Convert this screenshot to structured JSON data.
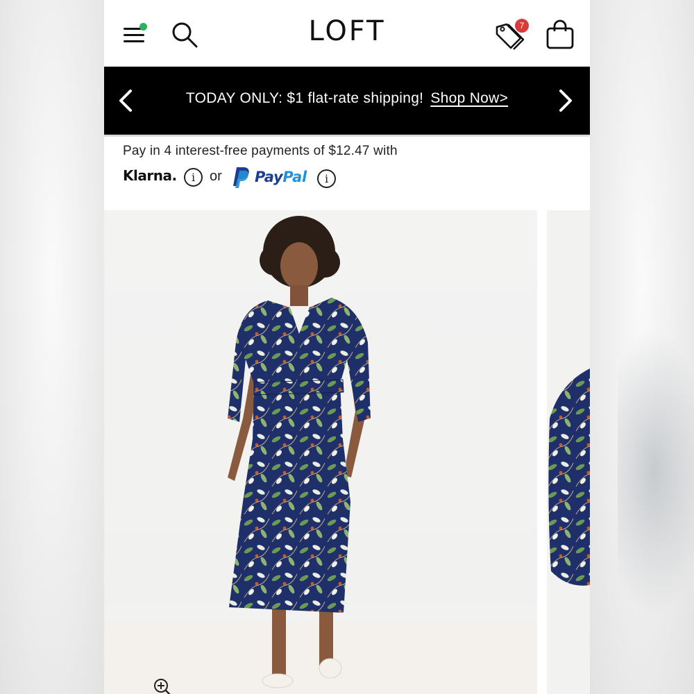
{
  "header": {
    "logo": "LOFT",
    "icons": [
      "menu-icon",
      "search-icon",
      "price-tag-icon",
      "shopping-bag-icon"
    ],
    "notification_count": "7",
    "colors": {
      "menu_dot": "#2bb35a",
      "badge": "#d93a3a"
    }
  },
  "promo_banner": {
    "message": "TODAY ONLY: $1 flat-rate shipping!",
    "link_label": "Shop Now>",
    "icons": [
      "chevron-left-icon",
      "chevron-right-icon"
    ],
    "background": "#000000"
  },
  "payment_options": {
    "text": "Pay in 4 interest-free payments of $12.47 with",
    "klarna_label": "Klarna.",
    "or_label": "or",
    "paypal_pay": "Pay",
    "paypal_pal": "Pal",
    "info_glyph": "i",
    "colors": {
      "paypal_dark": "#1a3f8e",
      "paypal_light": "#2590d6"
    }
  },
  "gallery": {
    "icons": [
      "zoom-in-icon"
    ]
  }
}
